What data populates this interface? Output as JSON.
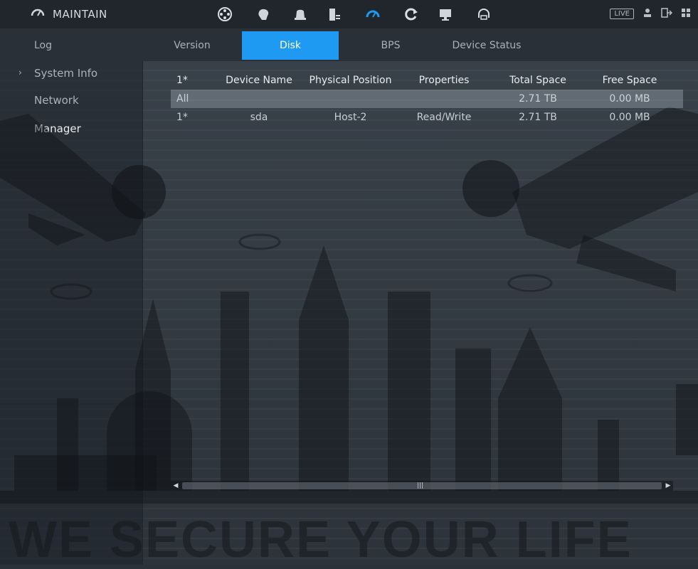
{
  "app": {
    "title": "MAINTAIN",
    "live_label": "LIVE"
  },
  "toolbar_icons": [
    "film-reel-icon",
    "brain-icon",
    "alarm-bell-icon",
    "storage-icon",
    "gauge-icon",
    "refresh-icon",
    "monitor-icon",
    "headset-icon"
  ],
  "tabs": [
    {
      "label": "Log"
    },
    {
      "label": "Version"
    },
    {
      "label": "Disk"
    },
    {
      "label": "BPS"
    },
    {
      "label": "Device Status"
    }
  ],
  "sidebar": {
    "items": [
      {
        "label": "System Info"
      },
      {
        "label": "Network"
      },
      {
        "label": "Manager"
      }
    ]
  },
  "disk_table": {
    "headers": [
      "1*",
      "Device Name",
      "Physical Position",
      "Properties",
      "Total Space",
      "Free Space"
    ],
    "all_row": {
      "index": "All",
      "total": "2.71 TB",
      "free": "0.00 MB"
    },
    "rows": [
      {
        "index": "1*",
        "name": "sda",
        "position": "Host-2",
        "properties": "Read/Write",
        "total": "2.71 TB",
        "free": "0.00 MB"
      }
    ]
  },
  "watermark": {
    "text": "WE SECURE YOUR LIFE"
  },
  "colors": {
    "accent": "#1e9af3",
    "topbar": "#21262c",
    "background": "#2b3138"
  }
}
